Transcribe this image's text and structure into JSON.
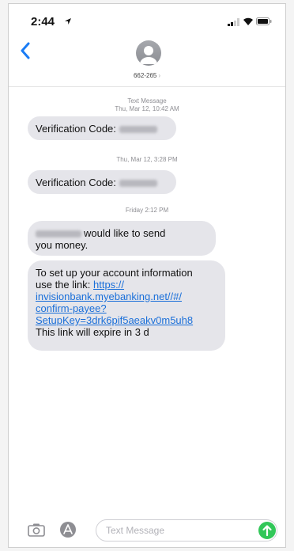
{
  "status_bar": {
    "time": "2:44"
  },
  "header": {
    "contact": "662-265",
    "chevron": "›"
  },
  "thread": {
    "ts1_label": "Text Message",
    "ts1_date": "Thu, Mar 12, 10:42 AM",
    "msg1_prefix": "Verification Code:",
    "ts2_date": "Thu, Mar 12, 3:28 PM",
    "msg2_prefix": "Verification Code:",
    "ts3_date": "Friday 2:12 PM",
    "msg3_line1": "would like to send",
    "msg3_line2": "you money.",
    "msg4_line1": "To set up your account information",
    "msg4_line2": "use the link:",
    "msg4_link1": "https://",
    "msg4_link2": "invisionbank.myebanking.net//#/",
    "msg4_link3": "confirm-payee?",
    "msg4_link4": "SetupKey=3drk6pif5aeakv0m5uh8",
    "msg4_last": "This link will expire in 3 d"
  },
  "input": {
    "placeholder": "Text Message"
  },
  "colors": {
    "bubble": "#e5e5ea",
    "link": "#1a6fd9",
    "send": "#32c759",
    "back": "#1a7cf5"
  }
}
